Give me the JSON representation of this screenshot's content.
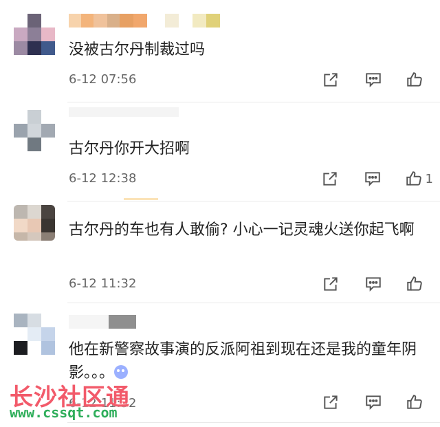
{
  "comments": [
    {
      "text": "没被古尔丹制裁过吗",
      "time": "6-12 07:56",
      "likes": ""
    },
    {
      "text": "古尔丹你开大招啊",
      "time": "6-12 12:38",
      "likes": "1"
    },
    {
      "text": "古尔丹的车也有人敢偷? 小心一记灵魂火送你起飞啊",
      "time": "6-12 11:32",
      "likes": ""
    },
    {
      "text": "他在新警察故事演的反派阿祖到现在还是我的童年阴影。。。",
      "time": "6-12 11:32",
      "likes": ""
    }
  ],
  "watermark": {
    "title": "长沙社区通",
    "url": "www.cssqt.com"
  },
  "icons": {
    "share": "share-icon",
    "comment": "comment-icon",
    "like": "thumbs-up-icon",
    "emoji": "emoji-icon"
  }
}
